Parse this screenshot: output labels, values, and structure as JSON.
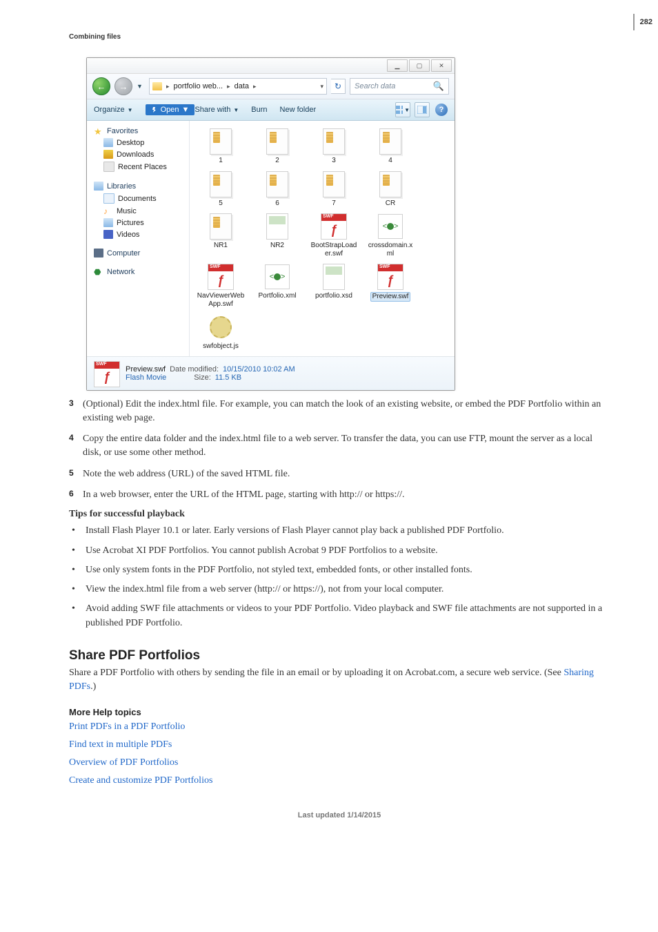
{
  "page_number": "282",
  "section_label": "Combining files",
  "explorer": {
    "breadcrumb": [
      "portfolio web...",
      "data"
    ],
    "search_placeholder": "Search data",
    "toolbar": {
      "organize": "Organize",
      "open": "Open",
      "share": "Share with",
      "burn": "Burn",
      "newfolder": "New folder"
    },
    "nav": {
      "favorites": "Favorites",
      "desktop": "Desktop",
      "downloads": "Downloads",
      "recent": "Recent Places",
      "libraries": "Libraries",
      "documents": "Documents",
      "music": "Music",
      "pictures": "Pictures",
      "videos": "Videos",
      "computer": "Computer",
      "network": "Network"
    },
    "tiles": [
      "1",
      "2",
      "3",
      "4",
      "5",
      "6",
      "7",
      "CR",
      "NR1",
      "NR2",
      "BootStrapLoader.swf",
      "crossdomain.xml",
      "NavViewerWebApp.swf",
      "Portfolio.xml",
      "portfolio.xsd",
      "Preview.swf",
      "swfobject.js"
    ],
    "details": {
      "name": "Preview.swf",
      "type": "Flash Movie",
      "date_label": "Date modified:",
      "date_val": "10/15/2010 10:02 AM",
      "size_label": "Size:",
      "size_val": "11.5 KB"
    }
  },
  "steps": {
    "s3": "(Optional) Edit the index.html file. For example, you can match the look of an existing website, or embed the PDF Portfolio within an existing web page.",
    "s4": "Copy the entire data folder and the index.html file to a web server. To transfer the data, you can use FTP, mount the server as a local disk, or use some other method.",
    "s5": "Note the web address (URL) of the saved HTML file.",
    "s6": "In a web browser, enter the URL of the HTML page, starting with http:// or https://."
  },
  "tips_heading": "Tips for successful playback",
  "tips": [
    "Install Flash Player 10.1 or later. Early versions of Flash Player cannot play back a published PDF Portfolio.",
    "Use Acrobat XI PDF Portfolios. You cannot publish Acrobat 9 PDF Portfolios to a website.",
    "Use only system fonts in the PDF Portfolio, not styled text, embedded fonts, or other installed fonts.",
    "View the index.html file from a web server (http:// or https://), not from your local computer.",
    "Avoid adding SWF file attachments or videos to your PDF Portfolio. Video playback and SWF file attachments are not supported in a published PDF Portfolio."
  ],
  "share_heading": "Share PDF Portfolios",
  "share_body_pre": "Share a PDF Portfolio with others by sending the file in an email or by uploading it on Acrobat.com, a secure web service. (See ",
  "share_link": "Sharing PDFs",
  "share_body_post": ".)",
  "more_help": "More Help topics",
  "help_links": [
    "Print PDFs in a PDF Portfolio",
    "Find text in multiple PDFs",
    "Overview of PDF Portfolios",
    "Create and customize PDF Portfolios"
  ],
  "footer": "Last updated 1/14/2015"
}
